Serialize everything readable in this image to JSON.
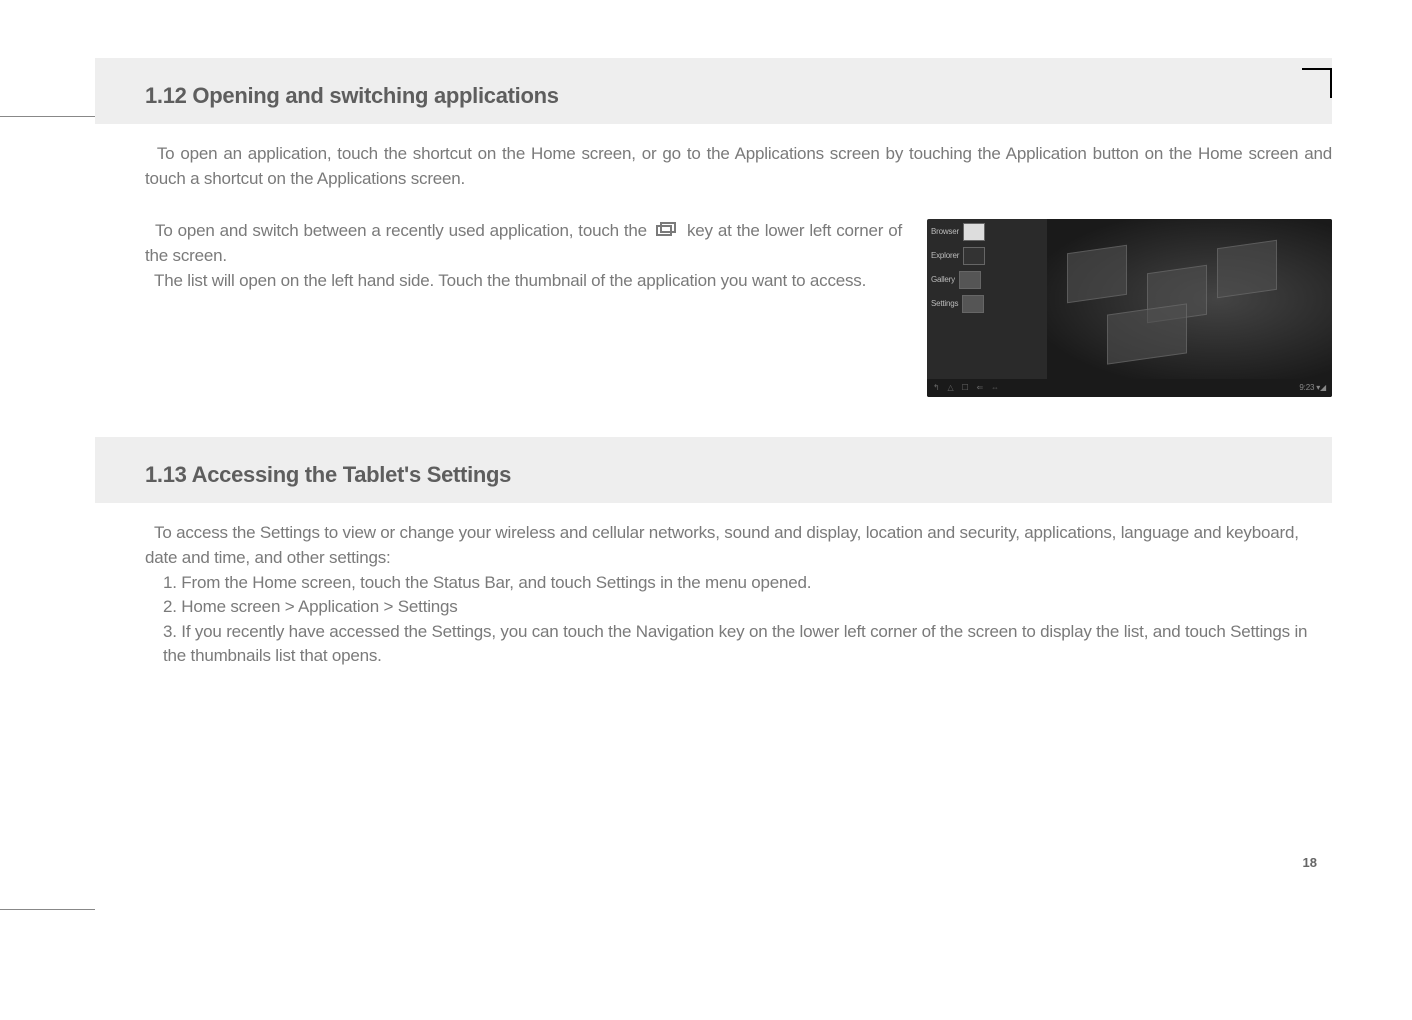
{
  "section1": {
    "heading": "1.12 Opening and switching applications",
    "para1": "To open an application, touch the shortcut on the Home screen, or go to the Applications screen by touching the Application button on the Home screen and touch a shortcut on the Applications screen.",
    "para2a": "To open and switch between a recently used application, touch the ",
    "para2b": " key at the lower left corner of the screen.",
    "para3": "The list will open on the left hand side. Touch the thumbnail of the application you want to access."
  },
  "screenshot": {
    "apps": [
      "Browser",
      "Explorer",
      "Gallery",
      "Settings"
    ],
    "navIcons": [
      "↰",
      "△",
      "☐",
      "⇐",
      "⇔"
    ],
    "time": "9:23"
  },
  "section2": {
    "heading": "1.13 Accessing the Tablet's Settings",
    "intro": "To access the Settings to view or change your wireless and cellular networks, sound and display, location and security, applications, language and keyboard, date and time, and other settings:",
    "step1": "1. From the Home screen, touch the Status Bar, and touch Settings in the menu opened.",
    "step2": "2. Home screen > Application > Settings",
    "step3": "3. If you recently have accessed the Settings, you can touch the Navigation key on the lower left corner of the screen to display the list, and touch Settings in the thumbnails list that opens."
  },
  "pageNumber": "18"
}
